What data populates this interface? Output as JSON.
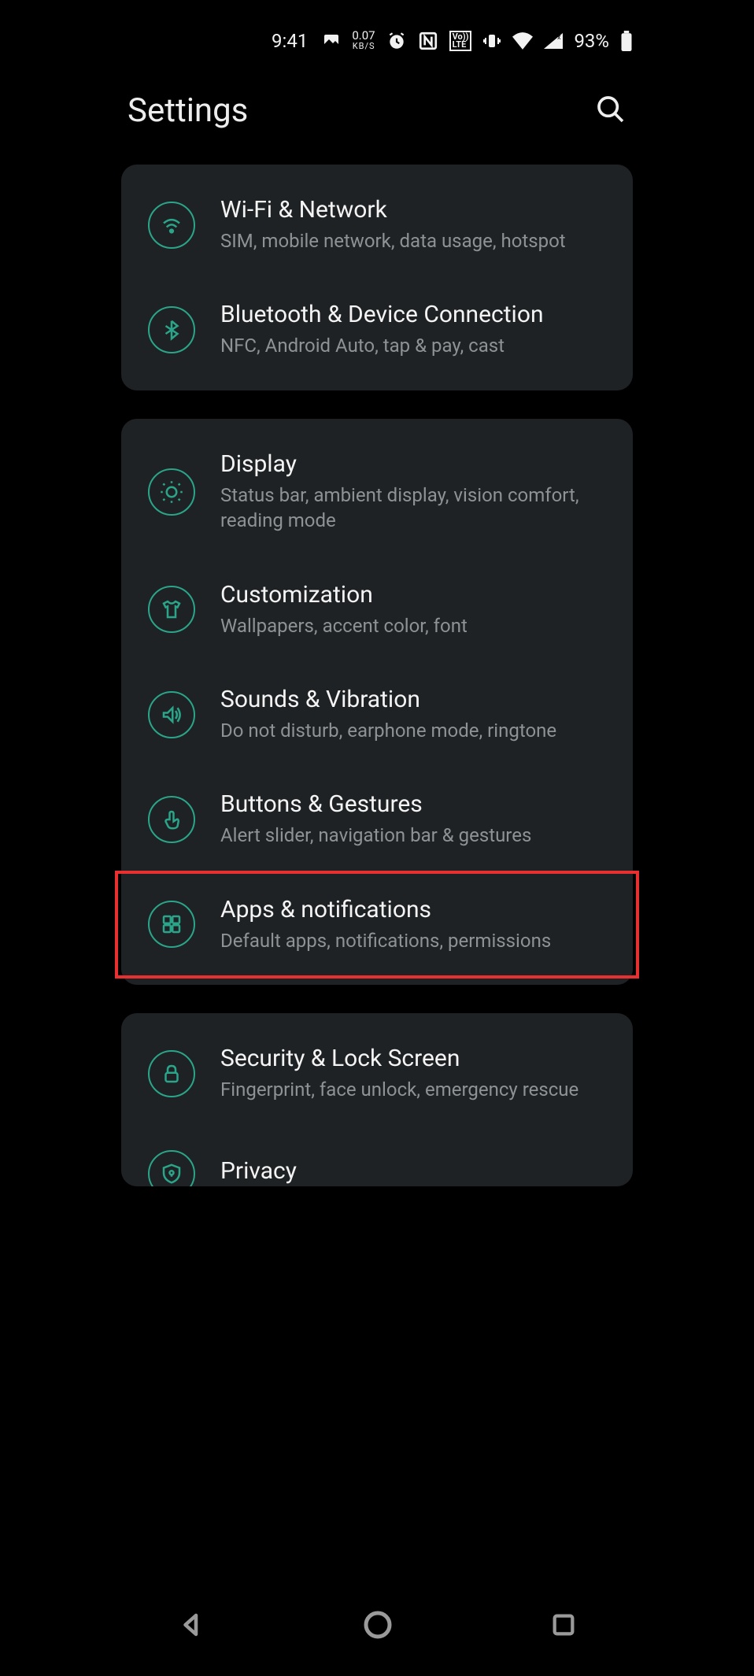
{
  "status": {
    "time": "9:41",
    "speed_value": "0.07",
    "speed_unit": "KB/S",
    "battery_pct": "93%",
    "volte_top": "Vo))",
    "volte_bot": "LTE"
  },
  "header": {
    "title": "Settings"
  },
  "groups": [
    {
      "items": [
        {
          "icon": "wifi",
          "title": "Wi-Fi & Network",
          "subtitle": "SIM, mobile network, data usage, hotspot"
        },
        {
          "icon": "bluetooth",
          "title": "Bluetooth & Device Connection",
          "subtitle": "NFC, Android Auto, tap & pay, cast"
        }
      ]
    },
    {
      "items": [
        {
          "icon": "display",
          "title": "Display",
          "subtitle": "Status bar, ambient display, vision comfort, reading mode"
        },
        {
          "icon": "customization",
          "title": "Customization",
          "subtitle": "Wallpapers, accent color, font"
        },
        {
          "icon": "sound",
          "title": "Sounds & Vibration",
          "subtitle": "Do not disturb, earphone mode, ringtone"
        },
        {
          "icon": "gesture",
          "title": "Buttons & Gestures",
          "subtitle": "Alert slider, navigation bar & gestures"
        },
        {
          "icon": "apps",
          "title": "Apps & notifications",
          "subtitle": "Default apps, notifications, permissions",
          "highlighted": true
        }
      ]
    },
    {
      "items": [
        {
          "icon": "lock",
          "title": "Security & Lock Screen",
          "subtitle": "Fingerprint, face unlock, emergency rescue"
        },
        {
          "icon": "privacy",
          "title": "Privacy",
          "subtitle": ""
        }
      ]
    }
  ]
}
